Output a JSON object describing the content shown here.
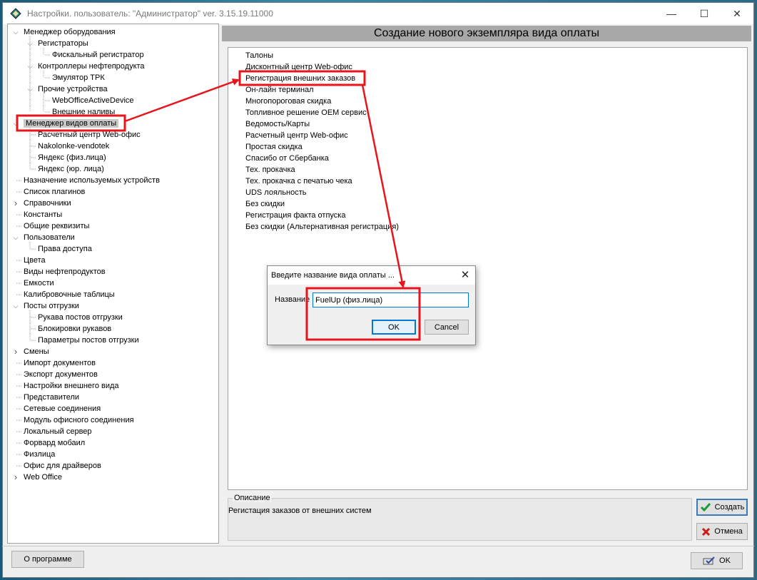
{
  "window": {
    "title": "Настройки. пользователь: \"Администратор\" ver. 3.15.19.11000",
    "minimize_glyph": "—",
    "maximize_glyph": "☐",
    "close_glyph": "✕"
  },
  "tree": {
    "items": [
      {
        "label": "Менеджер оборудования",
        "level": 0,
        "expander": "open"
      },
      {
        "label": "Регистраторы",
        "level": 1,
        "expander": "open"
      },
      {
        "label": "Фискальный регистратор",
        "level": 2,
        "expander": "none"
      },
      {
        "label": "Контроллеры нефтепродукта",
        "level": 1,
        "expander": "open"
      },
      {
        "label": "Эмулятор ТРК",
        "level": 2,
        "expander": "none"
      },
      {
        "label": "Прочие устройства",
        "level": 1,
        "expander": "open"
      },
      {
        "label": "WebOfficeActiveDevice",
        "level": 2,
        "expander": "none"
      },
      {
        "label": "Внешние наливы",
        "level": 2,
        "expander": "none"
      },
      {
        "label": "Менеджер видов оплаты",
        "level": 0,
        "expander": "open",
        "selected": true
      },
      {
        "label": "Расчетный центр Web-офис",
        "level": 1,
        "expander": "none"
      },
      {
        "label": "Nakolonke-vendotek",
        "level": 1,
        "expander": "none"
      },
      {
        "label": "Яндекс (физ.лица)",
        "level": 1,
        "expander": "none"
      },
      {
        "label": "Яндекс (юр. лица)",
        "level": 1,
        "expander": "none"
      },
      {
        "label": "Назначение используемых устройств",
        "level": 0,
        "expander": "none"
      },
      {
        "label": "Список плагинов",
        "level": 0,
        "expander": "none"
      },
      {
        "label": "Справочники",
        "level": 0,
        "expander": "closed"
      },
      {
        "label": "Константы",
        "level": 0,
        "expander": "none"
      },
      {
        "label": "Общие реквизиты",
        "level": 0,
        "expander": "none"
      },
      {
        "label": "Пользователи",
        "level": 0,
        "expander": "open"
      },
      {
        "label": "Права доступа",
        "level": 1,
        "expander": "none"
      },
      {
        "label": "Цвета",
        "level": 0,
        "expander": "none"
      },
      {
        "label": "Виды нефтепродуктов",
        "level": 0,
        "expander": "none"
      },
      {
        "label": "Емкости",
        "level": 0,
        "expander": "none"
      },
      {
        "label": "Калибровочные таблицы",
        "level": 0,
        "expander": "none"
      },
      {
        "label": "Посты отгрузки",
        "level": 0,
        "expander": "open"
      },
      {
        "label": "Рукава постов отгрузки",
        "level": 1,
        "expander": "none"
      },
      {
        "label": "Блокировки рукавов",
        "level": 1,
        "expander": "none"
      },
      {
        "label": "Параметры постов отгрузки",
        "level": 1,
        "expander": "none"
      },
      {
        "label": "Смены",
        "level": 0,
        "expander": "closed"
      },
      {
        "label": "Импорт документов",
        "level": 0,
        "expander": "none"
      },
      {
        "label": "Экспорт документов",
        "level": 0,
        "expander": "none"
      },
      {
        "label": "Настройки внешнего вида",
        "level": 0,
        "expander": "none"
      },
      {
        "label": "Представители",
        "level": 0,
        "expander": "none"
      },
      {
        "label": "Сетевые соединения",
        "level": 0,
        "expander": "none"
      },
      {
        "label": "Модуль офисного соединения",
        "level": 0,
        "expander": "none"
      },
      {
        "label": "Локальный сервер",
        "level": 0,
        "expander": "none"
      },
      {
        "label": "Форвард мобаил",
        "level": 0,
        "expander": "none"
      },
      {
        "label": "Физлица",
        "level": 0,
        "expander": "none"
      },
      {
        "label": "Офис для драйверов",
        "level": 0,
        "expander": "none"
      },
      {
        "label": "Web Office",
        "level": 0,
        "expander": "closed"
      }
    ]
  },
  "main": {
    "header": "Создание нового экземпляра вида оплаты",
    "payment_types": [
      "Талоны",
      "Дисконтный центр Web-офис",
      "Регистрация внешних заказов",
      "Он-лайн терминал",
      "Многопороговая скидка",
      "Топливное решение OEM сервис",
      "Ведомость/Карты",
      "Расчетный центр Web-офис",
      "Простая скидка",
      "Спасибо от Сбербанка",
      "Тех. прокачка",
      "Тех. прокачка с печатью чека",
      "UDS лояльность",
      "Без скидки",
      "Регистрация факта отпуска",
      "Без скидки (Альтернативная регистрация)"
    ],
    "description_legend": "Описание",
    "description_text": "Регистация заказов от внешних систем"
  },
  "buttons": {
    "create": "Создать",
    "cancel": "Отмена",
    "about": "О программе",
    "ok": "OK"
  },
  "dialog": {
    "title": "Введите название вида оплаты ...",
    "label": "Название",
    "value": "FuelUp (физ.лица)",
    "ok": "OK",
    "cancel": "Cancel",
    "close_glyph": "✕"
  },
  "colors": {
    "annotation": "#e8141c",
    "header_bg": "#a8a8a8",
    "create_check": "#1a9a3a",
    "cancel_x": "#d01818"
  }
}
